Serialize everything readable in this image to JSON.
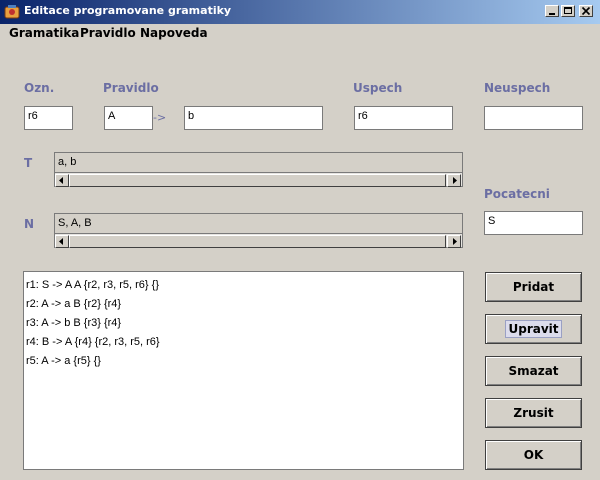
{
  "window": {
    "title": "Editace programovane gramatiky"
  },
  "menu": {
    "items": [
      "Gramatika",
      "Pravidlo",
      "Napoveda"
    ]
  },
  "form": {
    "ozn_label": "Ozn.",
    "pravidlo_label": "Pravidlo",
    "uspech_label": "Uspech",
    "neuspech_label": "Neuspech",
    "arrow": "->",
    "ozn_value": "r6",
    "left_value": "A",
    "right_value": "b",
    "uspech_value": "r6",
    "neuspech_value": "",
    "t_label": "T",
    "t_value": "a, b",
    "n_label": "N",
    "n_value": "S, A, B",
    "pocatecni_label": "Pocatecni",
    "pocatecni_value": "S"
  },
  "rules": [
    "r1: S -> A A {r2, r3, r5, r6} {}",
    "r2: A -> a B {r2} {r4}",
    "r3: A -> b B {r3} {r4}",
    "r4: B -> A {r4} {r2, r3, r5, r6}",
    "r5: A -> a {r5} {}"
  ],
  "buttons": {
    "pridat": "Pridat",
    "upravit": "Upravit",
    "smazat": "Smazat",
    "zrusit": "Zrusit",
    "ok": "OK"
  },
  "colors": {
    "label": "#6b6ea3",
    "titlebar_start": "#0a246a",
    "titlebar_end": "#a6caf0",
    "background": "#d4d0c8"
  }
}
